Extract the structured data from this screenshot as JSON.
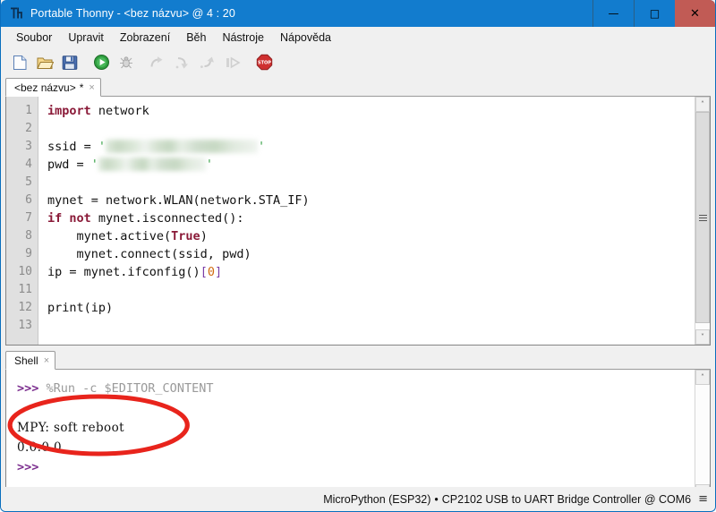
{
  "window": {
    "app_icon": "thonny-logo-icon",
    "title": "Portable Thonny  -  <bez názvu> @ 4 : 20",
    "buttons": {
      "minimize": "—",
      "maximize": "□",
      "close": "✕"
    }
  },
  "menubar": {
    "items": [
      {
        "label": "Soubor"
      },
      {
        "label": "Upravit"
      },
      {
        "label": "Zobrazení"
      },
      {
        "label": "Běh"
      },
      {
        "label": "Nástroje"
      },
      {
        "label": "Nápověda"
      }
    ]
  },
  "toolbar": {
    "items": [
      {
        "name": "new-file-icon",
        "title": "Nový"
      },
      {
        "name": "open-file-icon",
        "title": "Otevřít"
      },
      {
        "name": "save-file-icon",
        "title": "Uložit"
      },
      {
        "name": "run-icon",
        "title": "Spustit"
      },
      {
        "name": "debug-icon",
        "title": "Ladit"
      },
      {
        "name": "step-over-icon",
        "title": "Krok přes"
      },
      {
        "name": "step-into-icon",
        "title": "Krok do"
      },
      {
        "name": "step-out-icon",
        "title": "Krok ven"
      },
      {
        "name": "resume-icon",
        "title": "Pokračovat"
      },
      {
        "name": "stop-icon",
        "title": "Stop"
      }
    ]
  },
  "editor": {
    "tab": {
      "label": "<bez názvu>",
      "modified_marker": "*",
      "close_glyph": "×"
    },
    "line_numbers": [
      "1",
      "2",
      "3",
      "4",
      "5",
      "6",
      "7",
      "8",
      "9",
      "10",
      "11",
      "12",
      "13"
    ],
    "code_lines": [
      {
        "n": 1,
        "tokens": [
          {
            "t": "import",
            "c": "kw"
          },
          {
            "t": " network",
            "c": ""
          }
        ]
      },
      {
        "n": 2,
        "tokens": []
      },
      {
        "n": 3,
        "tokens": [
          {
            "t": "ssid = ",
            "c": ""
          },
          {
            "t": "'",
            "c": "str"
          },
          {
            "t": "REDACTED_SSID",
            "c": "redact-1"
          },
          {
            "t": "'",
            "c": "str"
          }
        ]
      },
      {
        "n": 4,
        "tokens": [
          {
            "t": "pwd = ",
            "c": ""
          },
          {
            "t": "'",
            "c": "str"
          },
          {
            "t": "REDACTED_PWD",
            "c": "redact-2"
          },
          {
            "t": "'",
            "c": "str"
          }
        ]
      },
      {
        "n": 5,
        "tokens": []
      },
      {
        "n": 6,
        "tokens": [
          {
            "t": "mynet = network.WLAN(network.STA_IF)",
            "c": ""
          }
        ]
      },
      {
        "n": 7,
        "tokens": [
          {
            "t": "if",
            "c": "kw"
          },
          {
            "t": " ",
            "c": ""
          },
          {
            "t": "not",
            "c": "kw"
          },
          {
            "t": " mynet.isconnected():",
            "c": ""
          }
        ]
      },
      {
        "n": 8,
        "tokens": [
          {
            "t": "    mynet.active(",
            "c": ""
          },
          {
            "t": "True",
            "c": "kw"
          },
          {
            "t": ")",
            "c": ""
          }
        ]
      },
      {
        "n": 9,
        "tokens": [
          {
            "t": "    mynet.connect(ssid, pwd)",
            "c": ""
          }
        ]
      },
      {
        "n": 10,
        "tokens": [
          {
            "t": "ip = mynet.ifconfig()",
            "c": ""
          },
          {
            "t": "[",
            "c": "brk"
          },
          {
            "t": "0",
            "c": "num"
          },
          {
            "t": "]",
            "c": "brk"
          }
        ]
      },
      {
        "n": 11,
        "tokens": []
      },
      {
        "n": 12,
        "tokens": [
          {
            "t": "print(ip)",
            "c": ""
          }
        ]
      },
      {
        "n": 13,
        "tokens": []
      }
    ],
    "scrollbar": {
      "up_glyph": "˄",
      "down_glyph": "˅"
    }
  },
  "shell": {
    "tab": {
      "label": "Shell",
      "close_glyph": "×"
    },
    "lines": [
      {
        "prompt": ">>> ",
        "text": "%Run -c $EDITOR_CONTENT",
        "style": "dim"
      },
      {
        "prompt": "",
        "text": "",
        "style": ""
      },
      {
        "prompt": "",
        "text": "MPY: soft reboot",
        "style": "output"
      },
      {
        "prompt": "",
        "text": "0.0.0.0",
        "style": "output"
      },
      {
        "prompt": ">>>",
        "text": "",
        "style": ""
      }
    ],
    "scrollbar": {
      "up_glyph": "˄",
      "down_glyph": "˅"
    },
    "annotation": {
      "name": "red-ellipse-highlight",
      "color": "#e8241c"
    }
  },
  "statusbar": {
    "interpreter": "MicroPython (ESP32)",
    "separator": "•",
    "device": "CP2102 USB to UART Bridge Controller @ COM6",
    "menu_glyph": "≡"
  },
  "colors": {
    "titlebar": "#127cce",
    "close_button": "#c15b55",
    "keyword": "#8a1a38",
    "string": "#2e9e3e",
    "prompt": "#7b2d8e",
    "annotation": "#e8241c"
  }
}
